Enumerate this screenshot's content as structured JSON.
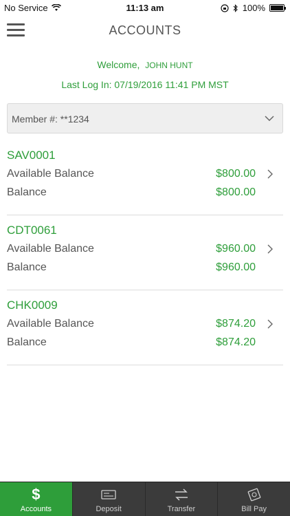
{
  "status_bar": {
    "carrier": "No Service",
    "time": "11:13 am",
    "battery": "100%"
  },
  "nav": {
    "title": "ACCOUNTS"
  },
  "welcome": {
    "greeting": "Welcome,",
    "name": "JOHN HUNT",
    "last_login": "Last Log In: 07/19/2016 11:41 PM MST"
  },
  "member": {
    "label": "Member #: **1234"
  },
  "accounts": [
    {
      "id": "SAV0001",
      "available_label": "Available Balance",
      "available": "$800.00",
      "balance_label": "Balance",
      "balance": "$800.00"
    },
    {
      "id": "CDT0061",
      "available_label": "Available Balance",
      "available": "$960.00",
      "balance_label": "Balance",
      "balance": "$960.00"
    },
    {
      "id": "CHK0009",
      "available_label": "Available Balance",
      "available": "$874.20",
      "balance_label": "Balance",
      "balance": "$874.20"
    }
  ],
  "tabs": [
    {
      "label": "Accounts",
      "icon": "dollar-icon",
      "active": true
    },
    {
      "label": "Deposit",
      "icon": "check-icon"
    },
    {
      "label": "Transfer",
      "icon": "transfer-icon"
    },
    {
      "label": "Bill Pay",
      "icon": "bill-icon"
    }
  ],
  "colors": {
    "accent": "#2e9e3a",
    "tab_bar": "#3b3b3b"
  }
}
